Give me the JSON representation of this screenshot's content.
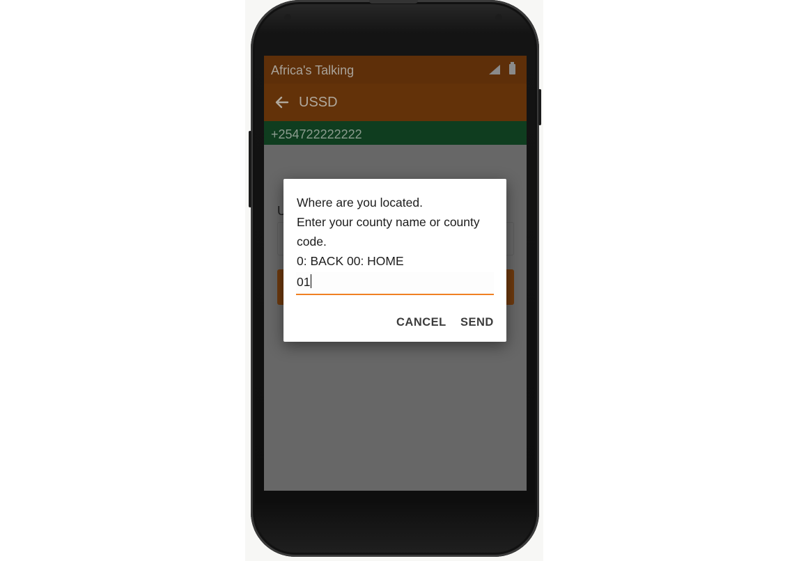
{
  "status_bar": {
    "title": "Africa's Talking",
    "icons": [
      "signal-icon",
      "battery-icon"
    ]
  },
  "app_bar": {
    "title": "USSD",
    "back_icon": "arrow-left-icon"
  },
  "phone_bar": {
    "number": "+254722222222"
  },
  "background_form": {
    "label_fragment": "U"
  },
  "dialog": {
    "lines": [
      "Where are you located.",
      "Enter your county name or county",
      "code.",
      "0: BACK 00: HOME"
    ],
    "input_value": "01",
    "cancel_label": "CANCEL",
    "send_label": "SEND"
  },
  "colors": {
    "status_bar": "#5e2f09",
    "app_bar": "#633209",
    "phone_bar": "#0f3d1f",
    "dim_background": "#676767",
    "input_accent": "#f08022"
  }
}
